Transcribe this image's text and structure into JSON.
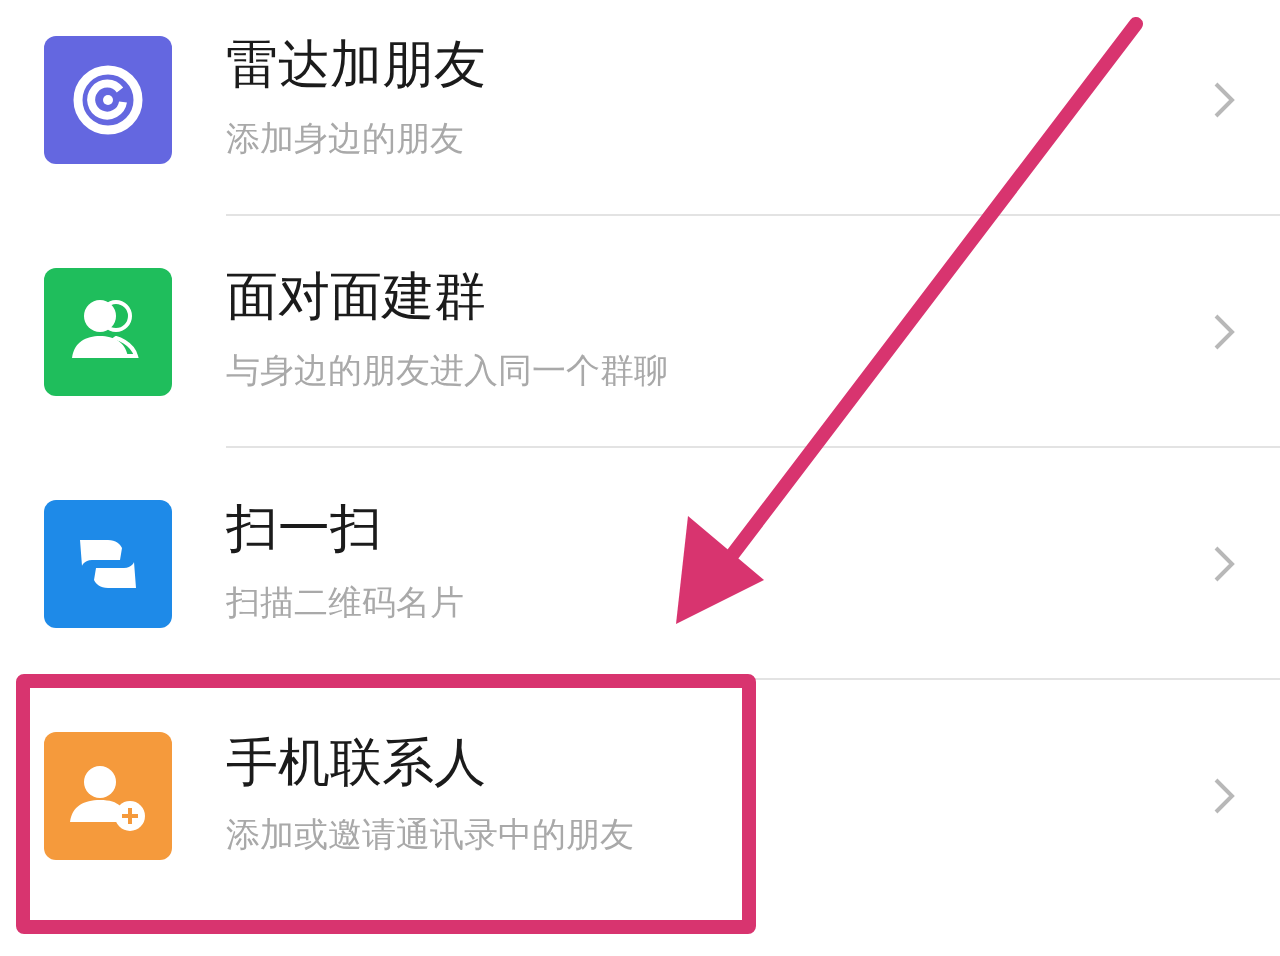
{
  "items": [
    {
      "color": "#6467e0",
      "title": "雷达加朋友",
      "subtitle": "添加身边的朋友",
      "highlighted": false
    },
    {
      "color": "#1fbe5c",
      "title": "面对面建群",
      "subtitle": "与身边的朋友进入同一个群聊",
      "highlighted": false
    },
    {
      "color": "#1e8ae8",
      "title": "扫一扫",
      "subtitle": "扫描二维码名片",
      "highlighted": false
    },
    {
      "color": "#f59a3c",
      "title": "手机联系人",
      "subtitle": "添加或邀请通讯录中的朋友",
      "highlighted": true
    }
  ]
}
